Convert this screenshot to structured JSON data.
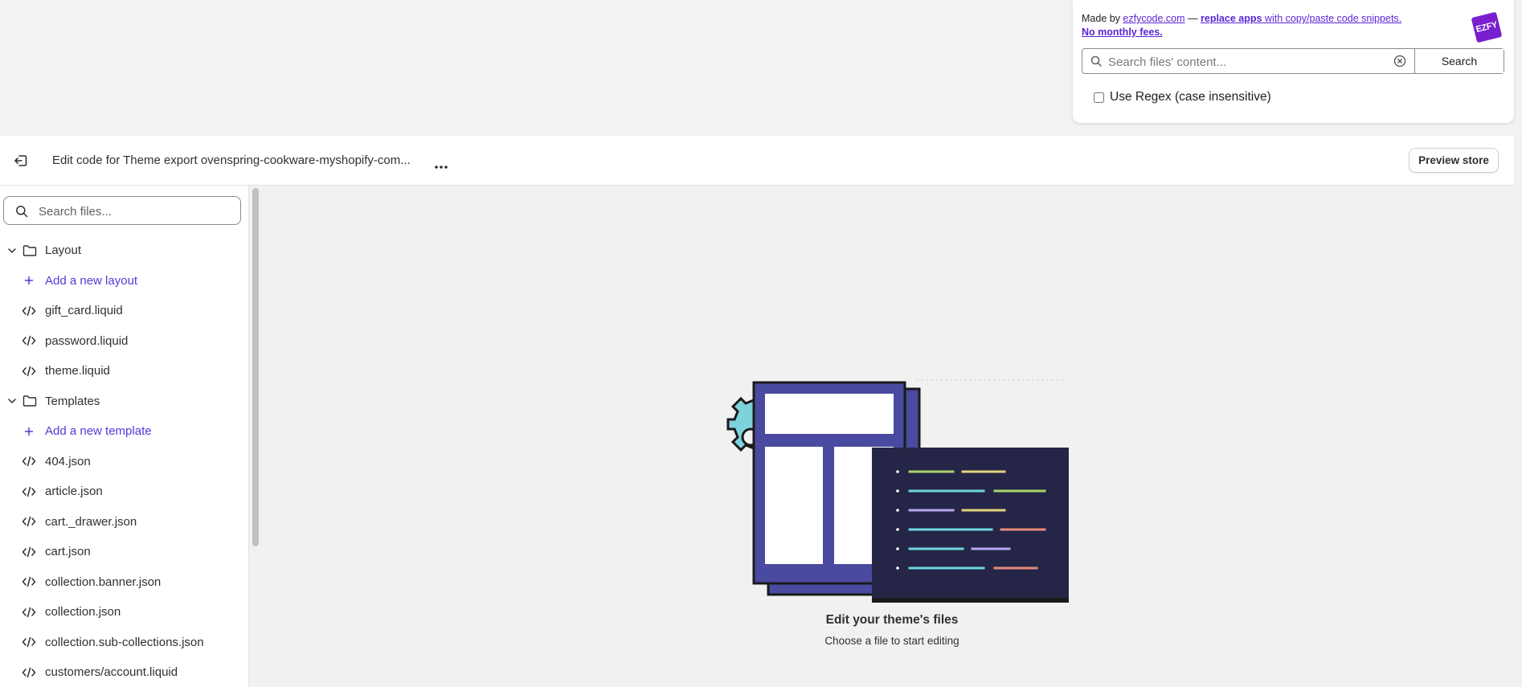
{
  "ezfy": {
    "credit_prefix": "Made by ",
    "credit_link": "ezfycode.com",
    "credit_dash": " — ",
    "credit_strong": "replace apps",
    "credit_rest": " with copy/paste code snippets.",
    "credit_fees": "No monthly fees.",
    "logo_text": "EZFY",
    "search_placeholder": "Search files' content...",
    "search_button": "Search",
    "regex_label": "Use Regex (case insensitive)"
  },
  "header": {
    "title": "Edit code for Theme export ovenspring-cookware-myshopify-com...",
    "preview_button": "Preview store"
  },
  "sidebar": {
    "search_placeholder": "Search files...",
    "items": [
      {
        "type": "folder",
        "label": "Layout"
      },
      {
        "type": "add",
        "label": "Add a new layout"
      },
      {
        "type": "file",
        "label": "gift_card.liquid"
      },
      {
        "type": "file",
        "label": "password.liquid"
      },
      {
        "type": "file",
        "label": "theme.liquid"
      },
      {
        "type": "folder",
        "label": "Templates"
      },
      {
        "type": "add",
        "label": "Add a new template"
      },
      {
        "type": "file",
        "label": "404.json"
      },
      {
        "type": "file",
        "label": "article.json"
      },
      {
        "type": "file",
        "label": "cart._drawer.json"
      },
      {
        "type": "file",
        "label": "cart.json"
      },
      {
        "type": "file",
        "label": "collection.banner.json"
      },
      {
        "type": "file",
        "label": "collection.json"
      },
      {
        "type": "file",
        "label": "collection.sub-collections.json"
      },
      {
        "type": "file",
        "label": "customers/account.liquid"
      }
    ]
  },
  "empty_state": {
    "title": "Edit your theme's files",
    "subtitle": "Choose a file to start editing"
  },
  "colors": {
    "accent": "#5a36d9",
    "ezfy_purple": "#7a1fd0",
    "illustration_navy": "#252647",
    "illustration_indigo": "#4a4aa0",
    "illustration_teal": "#7dd3dc"
  },
  "icons": {
    "exit": "exit-icon",
    "more": "more-horizontal-icon",
    "search": "search-icon",
    "clear": "clear-circle-icon",
    "folder": "folder-icon",
    "chevron": "chevron-down-icon",
    "plus": "plus-icon",
    "code": "code-icon"
  }
}
